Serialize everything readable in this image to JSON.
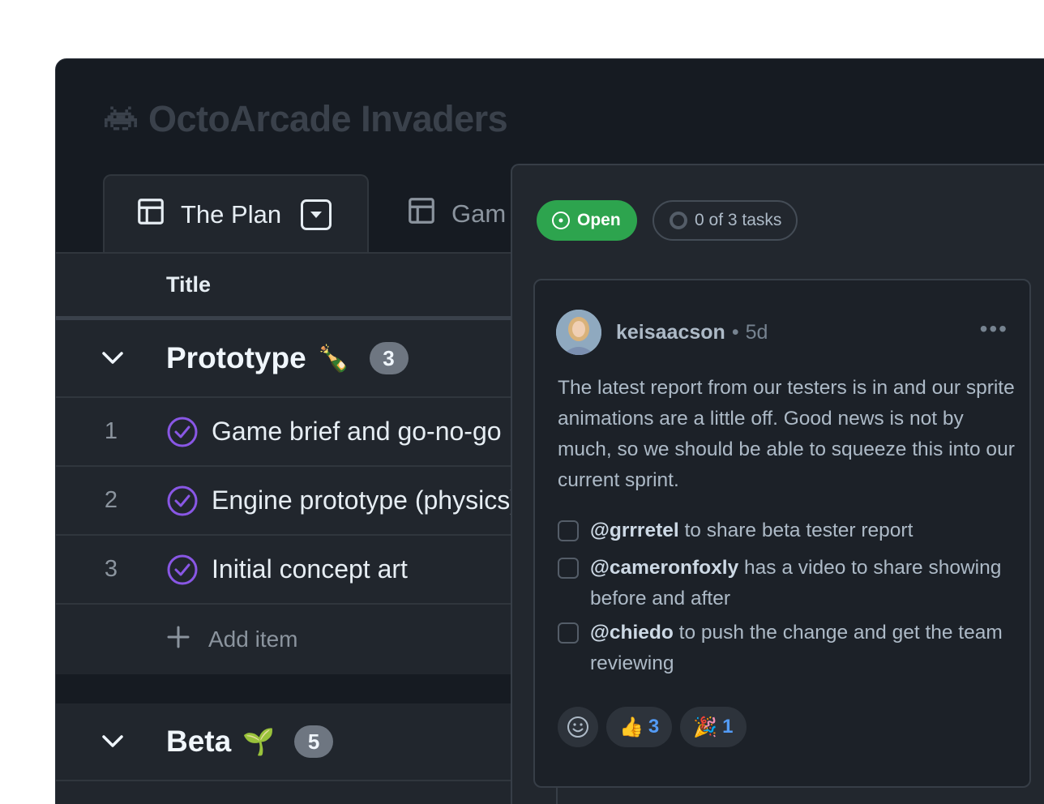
{
  "app": {
    "title": "OctoArcade Invaders",
    "icon": "space-invader-icon"
  },
  "tabs": [
    {
      "label": "The Plan",
      "icon": "table-icon",
      "active": true
    },
    {
      "label": "Gam",
      "icon": "table-icon",
      "active": false
    }
  ],
  "table": {
    "column_title": "Title",
    "groups": [
      {
        "name": "Prototype",
        "emoji": "🍾",
        "count": "3",
        "items": [
          {
            "num": "1",
            "title": "Game brief and go-no-go",
            "status": "done"
          },
          {
            "num": "2",
            "title": "Engine prototype (physics)",
            "status": "done"
          },
          {
            "num": "3",
            "title": "Initial concept art",
            "status": "done"
          }
        ],
        "add_label": "Add item"
      },
      {
        "name": "Beta",
        "emoji": "🌱",
        "count": "5"
      }
    ]
  },
  "panel": {
    "state_label": "Open",
    "tasks_label": "0 of 3 tasks",
    "comment": {
      "author": "keisaacson",
      "separator": "•",
      "age": "5d",
      "menu": "•••",
      "body": "The latest report from our testers is in and our sprite animations are a little off. Good news is not by much, so we should be able to squeeze this into our current sprint.",
      "tasks": [
        {
          "mention": "@grrretel",
          "text": " to share beta tester report",
          "checked": false
        },
        {
          "mention": "@cameronfoxly",
          "text": " has a video to share showing before and after",
          "checked": false
        },
        {
          "mention": "@chiedo",
          "text": " to push the change and get the team reviewing",
          "checked": false
        }
      ],
      "reactions": [
        {
          "emoji": "👍",
          "count": "3"
        },
        {
          "emoji": "🎉",
          "count": "1"
        }
      ]
    }
  },
  "colors": {
    "open_green": "#2da44e",
    "done_purple": "#8957e5",
    "link_blue": "#539bf5"
  }
}
